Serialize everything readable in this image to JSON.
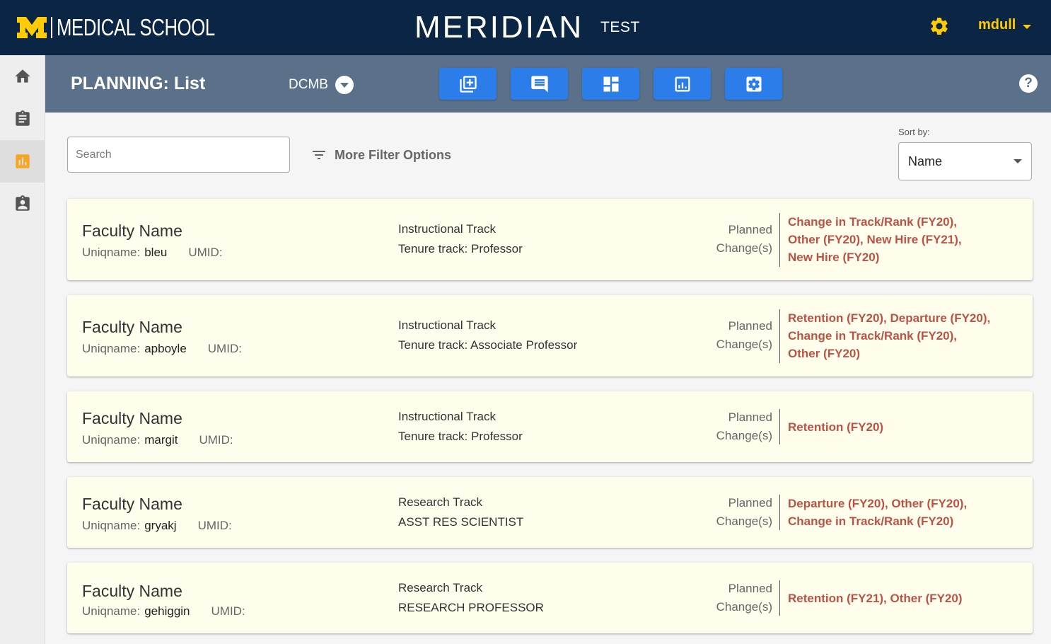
{
  "header": {
    "brand_text": "MEDICAL SCHOOL",
    "app_title": "MERIDIAN",
    "env_label": "TEST",
    "settings_icon": "gear-icon",
    "user": "mdull"
  },
  "sidebar": {
    "items": [
      {
        "icon": "home-icon"
      },
      {
        "icon": "clipboard-icon"
      },
      {
        "icon": "chart-icon",
        "active": true
      },
      {
        "icon": "badge-icon"
      }
    ]
  },
  "subheader": {
    "title": "PLANNING: List",
    "department": "DCMB",
    "tools": [
      "add-box-icon",
      "comment-icon",
      "dashboard-icon",
      "report-icon",
      "settings-box-icon"
    ],
    "help_label": "?"
  },
  "filters": {
    "search_placeholder": "Search",
    "more_filter_label": "More Filter Options",
    "sort_label": "Sort by:",
    "sort_value": "Name"
  },
  "labels": {
    "uniqname": "Uniqname:",
    "umid": "UMID:",
    "planned": "Planned",
    "changes": "Change(s)"
  },
  "records": [
    {
      "name": "Faculty Name",
      "uniqname": "bleu",
      "track": "Instructional Track",
      "rank": "Tenure track: Professor",
      "changes": [
        "Change in Track/Rank (FY20),",
        "Other (FY20), New Hire (FY21),",
        "New Hire (FY20)"
      ]
    },
    {
      "name": "Faculty Name",
      "uniqname": "apboyle",
      "track": "Instructional Track",
      "rank": "Tenure track: Associate Professor",
      "changes": [
        "Retention (FY20), Departure (FY20),",
        "Change in Track/Rank (FY20),",
        "Other (FY20)"
      ]
    },
    {
      "name": "Faculty Name",
      "uniqname": "margit",
      "track": "Instructional Track",
      "rank": "Tenure track: Professor",
      "changes": [
        "Retention (FY20)"
      ]
    },
    {
      "name": "Faculty Name",
      "uniqname": "gryakj",
      "track": "Research Track",
      "rank": "ASST RES SCIENTIST",
      "changes": [
        "Departure (FY20), Other (FY20),",
        "Change in Track/Rank (FY20)"
      ]
    },
    {
      "name": "Faculty Name",
      "uniqname": "gehiggin",
      "track": "Research Track",
      "rank": "RESEARCH PROFESSOR",
      "changes": [
        "Retention (FY21), Other (FY20)"
      ]
    }
  ]
}
